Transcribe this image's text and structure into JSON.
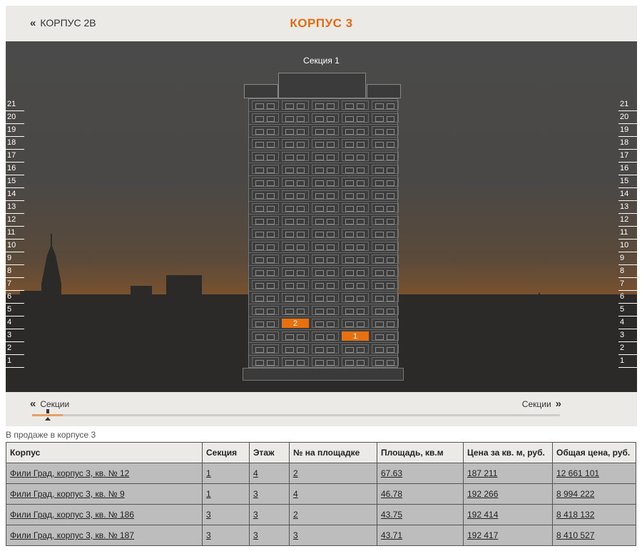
{
  "header": {
    "back_label": "КОРПУС 2В",
    "title": "КОРПУС 3"
  },
  "scene": {
    "section_label": "Секция 1",
    "floors": [
      "21",
      "20",
      "19",
      "18",
      "17",
      "16",
      "15",
      "14",
      "13",
      "12",
      "11",
      "10",
      "9",
      "8",
      "7",
      "6",
      "5",
      "4",
      "3",
      "2",
      "1"
    ],
    "highlighted_apartments": [
      {
        "floor": "4",
        "column": "2",
        "label": "2"
      },
      {
        "floor": "3",
        "column": "4",
        "label": "1"
      }
    ]
  },
  "sections_nav": {
    "prev_label": "Секции",
    "next_label": "Секции"
  },
  "table": {
    "caption": "В продаже в корпусе 3",
    "headers": [
      "Корпус",
      "Секция",
      "Этаж",
      "№ на площадке",
      "Площадь, кв.м",
      "Цена за кв. м, руб.",
      "Общая цена, руб."
    ],
    "rows": [
      [
        "Фили Град, корпус 3, кв. № 12",
        "1",
        "4",
        "2",
        "67.63",
        "187 211",
        "12 661 101"
      ],
      [
        "Фили Град, корпус 3, кв. № 9",
        "1",
        "3",
        "4",
        "46.78",
        "192 266",
        "8 994 222"
      ],
      [
        "Фили Град, корпус 3, кв. № 186",
        "3",
        "3",
        "2",
        "43.75",
        "192 414",
        "8 418 132"
      ],
      [
        "Фили Град, корпус 3, кв. № 187",
        "3",
        "3",
        "3",
        "43.71",
        "192 417",
        "8 410 527"
      ]
    ]
  },
  "colors": {
    "accent": "#e8700f",
    "header_bg": "#ebeae6",
    "row_bg": "#bdbdbd"
  }
}
